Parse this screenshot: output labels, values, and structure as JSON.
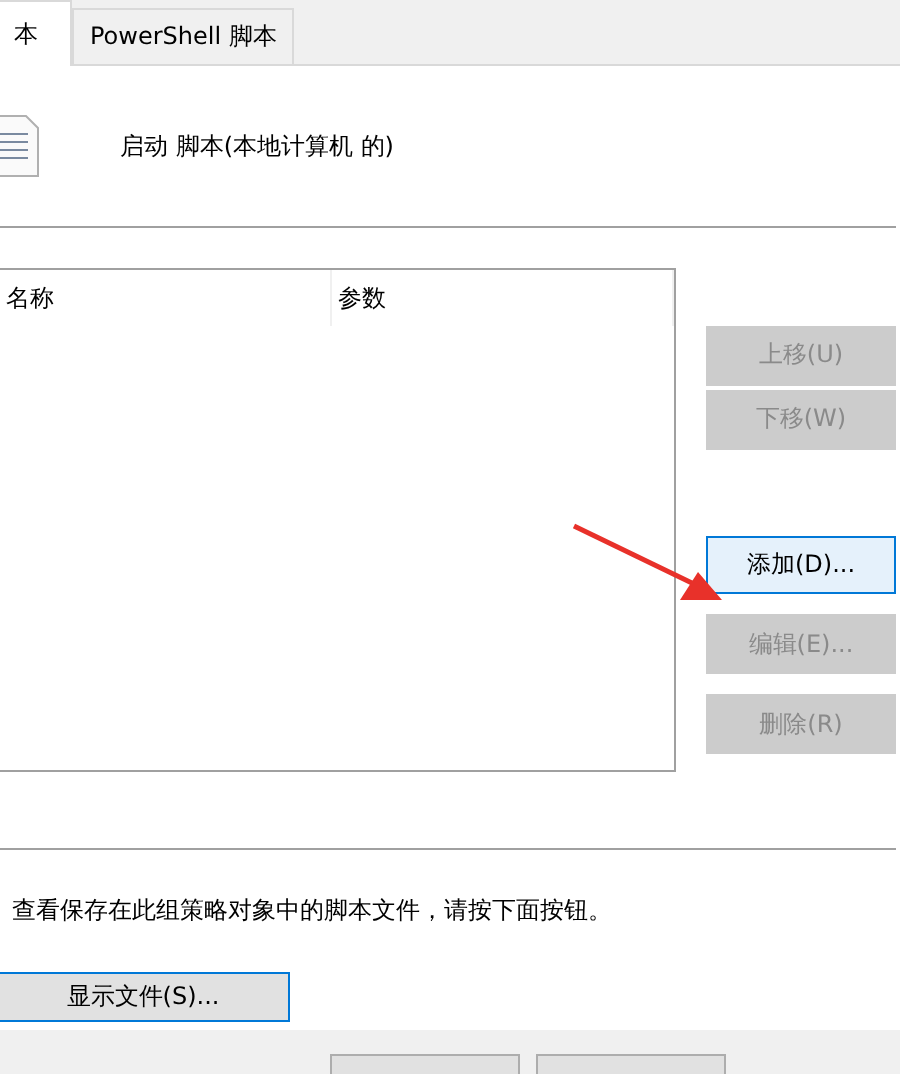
{
  "tabs": [
    {
      "label": "本",
      "selected": true
    },
    {
      "label": "PowerShell 脚本",
      "selected": false
    }
  ],
  "heading": "启动 脚本(本地计算机 的)",
  "list": {
    "columns": [
      "名称",
      "参数"
    ]
  },
  "side_buttons": [
    {
      "label": "上移(U)",
      "disabled": true,
      "focused": false
    },
    {
      "label": "下移(W)",
      "disabled": true,
      "focused": false
    },
    {
      "label": "添加(D)...",
      "disabled": false,
      "focused": true
    },
    {
      "label": "编辑(E)...",
      "disabled": true,
      "focused": false
    },
    {
      "label": "删除(R)",
      "disabled": true,
      "focused": false
    }
  ],
  "description": "查看保存在此组策略对象中的脚本文件，请按下面按钮。",
  "show_files_button": "显示文件(S)..."
}
